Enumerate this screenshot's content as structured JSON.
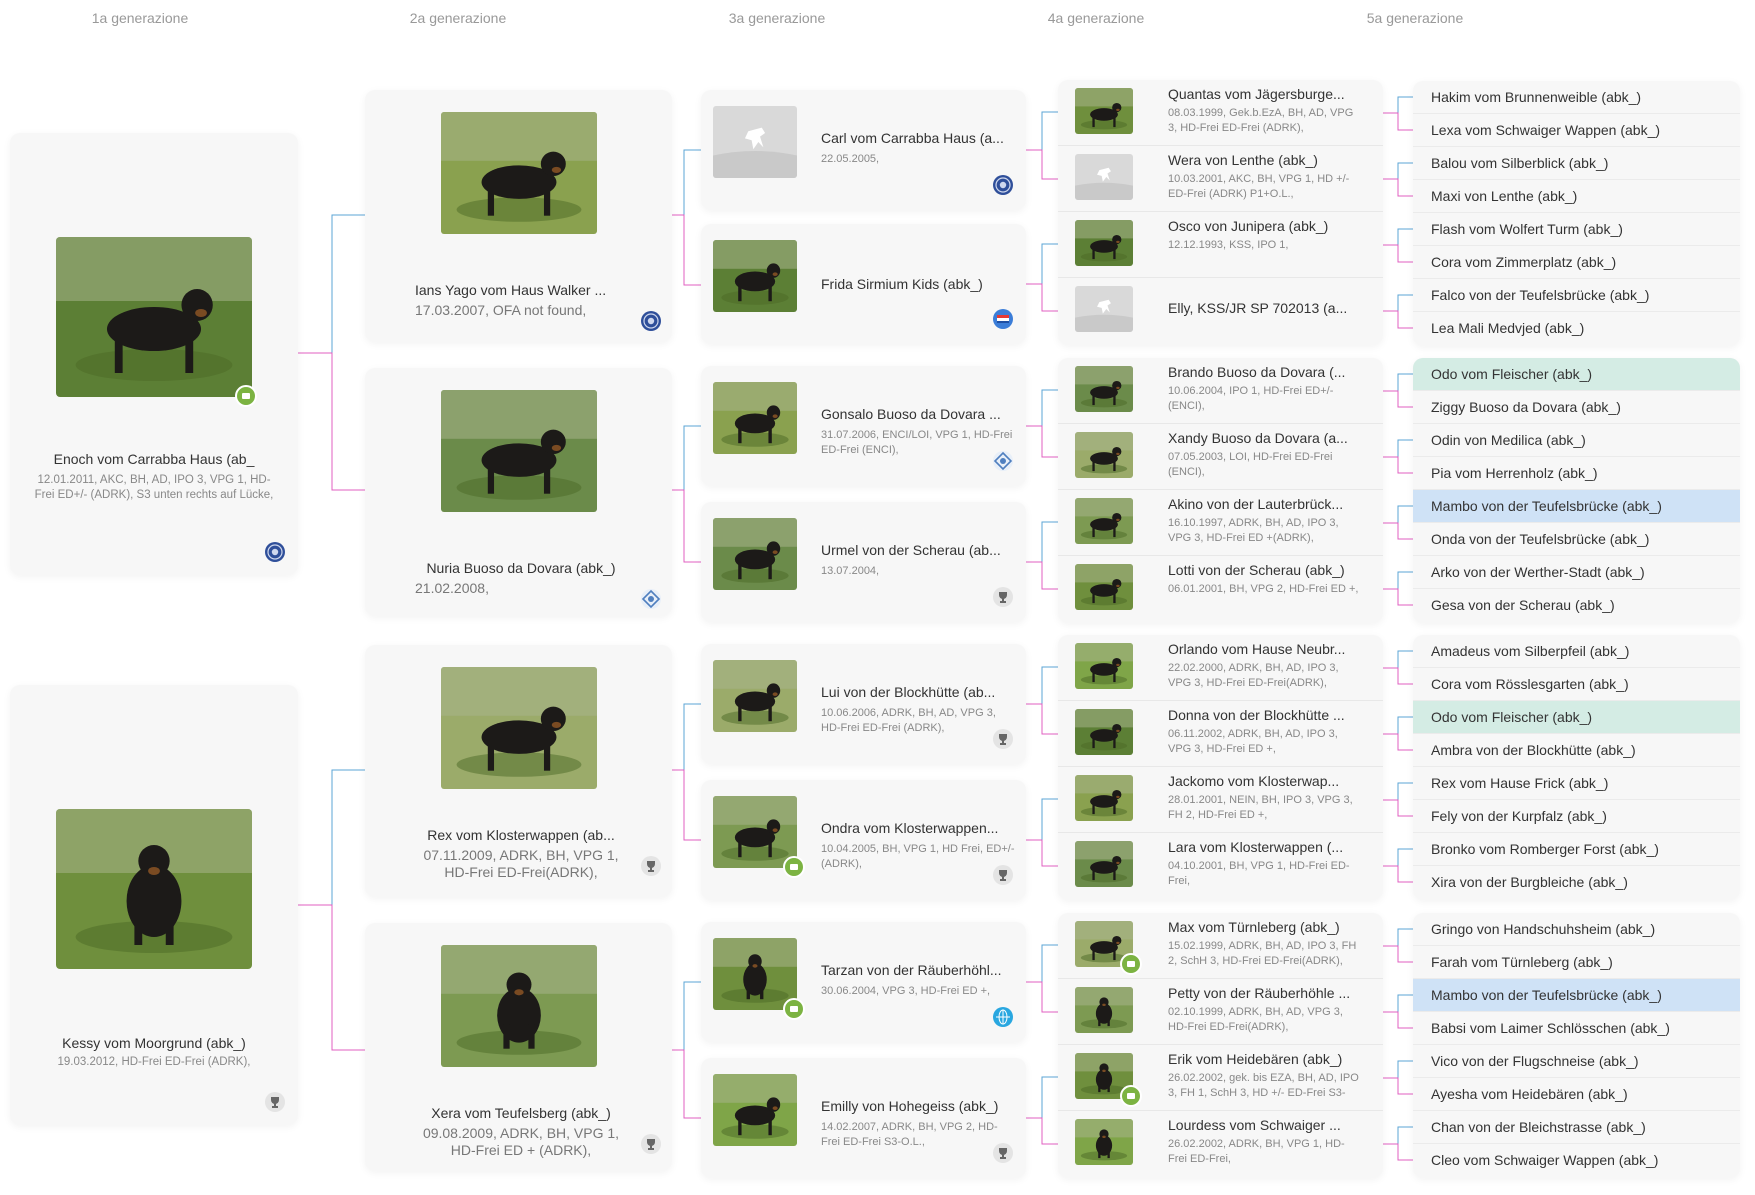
{
  "headers": [
    "1a generazione",
    "2a generazione",
    "3a generazione",
    "4a generazione",
    "5a generazione"
  ],
  "colors": {
    "sire_line": "#5ba4d6",
    "dam_line": "#e05fc1",
    "highlight_green": "#d4ece4",
    "highlight_blue": "#cfe2f6",
    "video_badge": "#7cb342"
  },
  "gen1": [
    {
      "name": "Enoch vom Carrabba Haus (ab_",
      "info": "12.01.2011, AKC, BH, AD, IPO 3, VPG 1, HD-Frei ED+/- (ADRK), S3 unten rechts auf Lücke,",
      "badge": "club-badge-blue",
      "video": true
    },
    {
      "name": "Kessy vom Moorgrund (abk_)",
      "info": "19.03.2012, HD-Frei ED-Frei (ADRK),",
      "badge": "trophy-badge",
      "video": false
    }
  ],
  "gen2": [
    {
      "name": "Ians Yago vom Haus Walker ...",
      "info": "17.03.2007, OFA not found,",
      "badge": "club-badge-blue"
    },
    {
      "name": "Nuria Buoso da Dovara (abk_)",
      "info": "21.02.2008,",
      "badge": "diamond-badge"
    },
    {
      "name": "Rex vom Klosterwappen (ab...",
      "info": "07.11.2009, ADRK, BH, VPG 1, HD-Frei ED-Frei(ADRK),",
      "badge": "trophy-badge"
    },
    {
      "name": "Xera vom Teufelsberg (abk_)",
      "info": "09.08.2009, ADRK, BH, VPG 1, HD-Frei ED + (ADRK),",
      "badge": "trophy-badge"
    }
  ],
  "gen3": [
    {
      "name": "Carl vom Carrabba Haus (a...",
      "info": "22.05.2005,",
      "badge": "club-badge-blue",
      "placeholder": true,
      "video": false
    },
    {
      "name": "Frida Sirmium Kids (abk_)",
      "info": "",
      "badge": "flag-badge",
      "placeholder": false,
      "video": false
    },
    {
      "name": "Gonsalo Buoso da Dovara ...",
      "info": "31.07.2006, ENCI/LOI, VPG 1, HD-Frei ED-Frei (ENCI),",
      "badge": "diamond-badge",
      "placeholder": false,
      "video": false
    },
    {
      "name": "Urmel von der Scherau (ab...",
      "info": "13.07.2004,",
      "badge": "trophy-badge",
      "placeholder": false,
      "video": false
    },
    {
      "name": "Lui von der Blockhütte (ab...",
      "info": "10.06.2006, ADRK, BH, AD, VPG 3, HD-Frei ED-Frei (ADRK),",
      "badge": "trophy-badge",
      "placeholder": false,
      "video": false
    },
    {
      "name": "Ondra vom Klosterwappen...",
      "info": "10.04.2005, BH, VPG 1, HD Frei, ED+/- (ADRK),",
      "badge": "trophy-badge",
      "placeholder": false,
      "video": true
    },
    {
      "name": "Tarzan von der Räuberhöhl...",
      "info": "30.06.2004, VPG 3, HD-Frei ED +,",
      "badge": "globe-badge",
      "placeholder": false,
      "video": true
    },
    {
      "name": "Emilly von Hohegeiss (abk_)",
      "info": "14.02.2007, ADRK, BH, VPG 2, HD-Frei ED-Frei S3-O.L.,",
      "badge": "trophy-badge",
      "placeholder": false,
      "video": false
    }
  ],
  "gen4": [
    {
      "name": "Quantas vom Jägersburge...",
      "info": "08.03.1999, Gek.b.EzA, BH, AD, VPG 3, HD-Frei ED-Frei (ADRK),",
      "placeholder": false,
      "video": false
    },
    {
      "name": "Wera von Lenthe (abk_)",
      "info": "10.03.2001, AKC, BH, VPG 1, HD +/- ED-Frei (ADRK) P1+O.L.,",
      "placeholder": true,
      "video": false
    },
    {
      "name": "Osco von Junipera (abk_)",
      "info": "12.12.1993, KSS, IPO 1,",
      "placeholder": false,
      "video": false
    },
    {
      "name": "Elly, KSS/JR SP 702013 (a...",
      "info": "",
      "placeholder": true,
      "video": false
    },
    {
      "name": "Brando Buoso da Dovara (...",
      "info": "10.06.2004, IPO 1, HD-Frei ED+/- (ENCI),",
      "placeholder": false,
      "video": false
    },
    {
      "name": "Xandy Buoso da Dovara (a...",
      "info": "07.05.2003, LOI, HD-Frei ED-Frei (ENCI),",
      "placeholder": false,
      "video": false
    },
    {
      "name": "Akino von der Lauterbrück...",
      "info": "16.10.1997, ADRK, BH, AD, IPO 3, VPG 3, HD-Frei ED +(ADRK),",
      "placeholder": false,
      "video": false
    },
    {
      "name": "Lotti von der Scherau (abk_)",
      "info": "06.01.2001, BH, VPG 2, HD-Frei ED +,",
      "placeholder": false,
      "video": false
    },
    {
      "name": "Orlando vom Hause Neubr...",
      "info": "22.02.2000, ADRK, BH, AD, IPO 3, VPG 3, HD-Frei ED-Frei(ADRK),",
      "placeholder": false,
      "video": false
    },
    {
      "name": "Donna von der Blockhütte ...",
      "info": "06.11.2002, ADRK, BH, AD, IPO 3, VPG 3, HD-Frei ED +,",
      "placeholder": false,
      "video": false
    },
    {
      "name": "Jackomo vom Klosterwap...",
      "info": "28.01.2001, NEIN, BH, IPO 3, VPG 3, FH 2, HD-Frei ED +,",
      "placeholder": false,
      "video": false
    },
    {
      "name": "Lara vom Klosterwappen (...",
      "info": "04.10.2001, BH, VPG 1, HD-Frei ED-Frei,",
      "placeholder": false,
      "video": false
    },
    {
      "name": "Max vom Türnleberg (abk_)",
      "info": "15.02.1999, ADRK, BH, AD, IPO 3, FH 2, SchH 3, HD-Frei ED-Frei(ADRK),",
      "placeholder": false,
      "video": true
    },
    {
      "name": "Petty von der Räuberhöhle ...",
      "info": "02.10.1999, ADRK, BH, AD, VPG 3, HD-Frei ED-Frei(ADRK),",
      "placeholder": false,
      "video": false
    },
    {
      "name": "Erik vom Heidebären (abk_)",
      "info": "26.02.2002, gek. bis EZA, BH, AD, IPO 3, FH 1, SchH 3, HD +/- ED-Frei S3-",
      "placeholder": false,
      "video": true
    },
    {
      "name": "Lourdess vom Schwaiger ...",
      "info": "26.02.2002, ADRK, BH, VPG 1, HD-Frei ED-Frei,",
      "placeholder": false,
      "video": false
    }
  ],
  "gen5": [
    {
      "name": "Hakim vom Brunnenweible (abk_)",
      "hl": ""
    },
    {
      "name": "Lexa vom Schwaiger Wappen (abk_)",
      "hl": ""
    },
    {
      "name": "Balou vom Silberblick (abk_)",
      "hl": ""
    },
    {
      "name": "Maxi von Lenthe (abk_)",
      "hl": ""
    },
    {
      "name": "Flash vom Wolfert Turm (abk_)",
      "hl": ""
    },
    {
      "name": "Cora vom Zimmerplatz (abk_)",
      "hl": ""
    },
    {
      "name": "Falco von der Teufelsbrücke (abk_)",
      "hl": ""
    },
    {
      "name": "Lea Mali Medvjed (abk_)",
      "hl": ""
    },
    {
      "name": "Odo vom Fleischer (abk_)",
      "hl": "green"
    },
    {
      "name": "Ziggy Buoso da Dovara (abk_)",
      "hl": ""
    },
    {
      "name": "Odin von Medilica (abk_)",
      "hl": ""
    },
    {
      "name": "Pia vom Herrenholz (abk_)",
      "hl": ""
    },
    {
      "name": "Mambo von der Teufelsbrücke (abk_)",
      "hl": "blue"
    },
    {
      "name": "Onda von der Teufelsbrücke (abk_)",
      "hl": ""
    },
    {
      "name": "Arko von der Werther-Stadt (abk_)",
      "hl": ""
    },
    {
      "name": "Gesa von der Scherau (abk_)",
      "hl": ""
    },
    {
      "name": "Amadeus vom Silberpfeil (abk_)",
      "hl": ""
    },
    {
      "name": "Cora vom Rösslesgarten (abk_)",
      "hl": ""
    },
    {
      "name": "Odo vom Fleischer (abk_)",
      "hl": "green"
    },
    {
      "name": "Ambra von der Blockhütte (abk_)",
      "hl": ""
    },
    {
      "name": "Rex vom Hause Frick (abk_)",
      "hl": ""
    },
    {
      "name": "Fely von der Kurpfalz (abk_)",
      "hl": ""
    },
    {
      "name": "Bronko vom Romberger Forst (abk_)",
      "hl": ""
    },
    {
      "name": "Xira von der Burgbleiche (abk_)",
      "hl": ""
    },
    {
      "name": "Gringo von Handschuhsheim (abk_)",
      "hl": ""
    },
    {
      "name": "Farah vom Türnleberg (abk_)",
      "hl": ""
    },
    {
      "name": "Mambo von der Teufelsbrücke (abk_)",
      "hl": "blue"
    },
    {
      "name": "Babsi vom Laimer Schlösschen (abk_)",
      "hl": ""
    },
    {
      "name": "Vico von der Flugschneise (abk_)",
      "hl": ""
    },
    {
      "name": "Ayesha vom Heidebären (abk_)",
      "hl": ""
    },
    {
      "name": "Chan von der Bleichstrasse (abk_)",
      "hl": ""
    },
    {
      "name": "Cleo vom Schwaiger Wappen (abk_)",
      "hl": ""
    }
  ]
}
